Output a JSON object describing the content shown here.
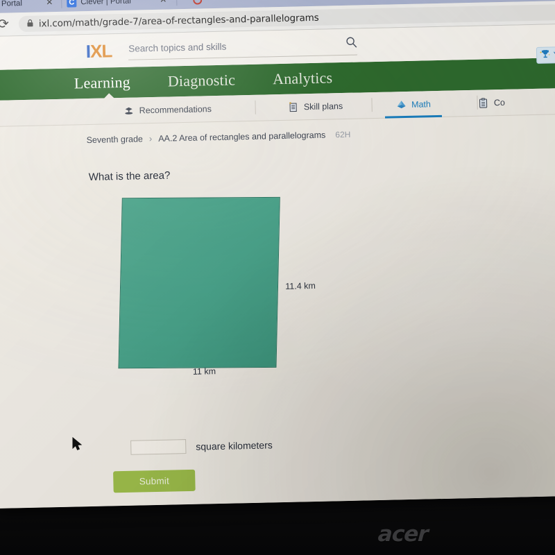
{
  "browser": {
    "tabs": [
      {
        "title": "er | Portal",
        "favicon": "none",
        "truncated": true
      },
      {
        "title": "Clever | Portal",
        "favicon": "clever-c-icon"
      },
      {
        "title": "",
        "favicon": "red-ring-icon"
      }
    ],
    "close_label": "✕",
    "reload_icon": "⟳",
    "lock_icon": "🔒",
    "url": "ixl.com/math/grade-7/area-of-rectangles-and-parallelograms"
  },
  "ixl": {
    "logo": {
      "part1": "I",
      "part2": "XL"
    },
    "search": {
      "value": "",
      "placeholder": "Search topics and skills",
      "icon": "search-icon"
    },
    "nav": [
      {
        "label": "Learning",
        "active": true
      },
      {
        "label": "Diagnostic",
        "active": false
      },
      {
        "label": "Analytics",
        "active": false
      }
    ],
    "subnav": [
      {
        "label": "Recommendations",
        "icon": "recommendations-icon",
        "selected": false
      },
      {
        "label": "Skill plans",
        "icon": "skill-plans-icon",
        "selected": false
      },
      {
        "label": "Math",
        "icon": "math-pyramid-icon",
        "selected": true
      },
      {
        "label": "Co",
        "icon": "clipboard-icon",
        "selected": false
      }
    ],
    "award_badge": {
      "icon": "trophy-icon",
      "label": "Y"
    },
    "breadcrumb": {
      "grade": "Seventh grade",
      "separator": "›",
      "skill": "AA.2 Area of rectangles and parallelograms",
      "code": "62H"
    }
  },
  "problem": {
    "question": "What is the area?",
    "figure": {
      "shape": "rectangle",
      "height_label": "11.4 km",
      "width_label": "11 km",
      "fill_color": "#4aa48c",
      "stroke_color": "#2f7a66"
    },
    "answer": {
      "value": "",
      "placeholder": "",
      "unit": "square kilometers"
    },
    "submit_label": "Submit"
  },
  "device": {
    "brand_logo": "acer"
  },
  "colors": {
    "nav_green": "#2e6b2e",
    "accent_blue": "#1a7fc1",
    "submit_green": "#9dbe4b",
    "logo_blue": "#2f62c4",
    "logo_orange": "#e08a2e"
  }
}
